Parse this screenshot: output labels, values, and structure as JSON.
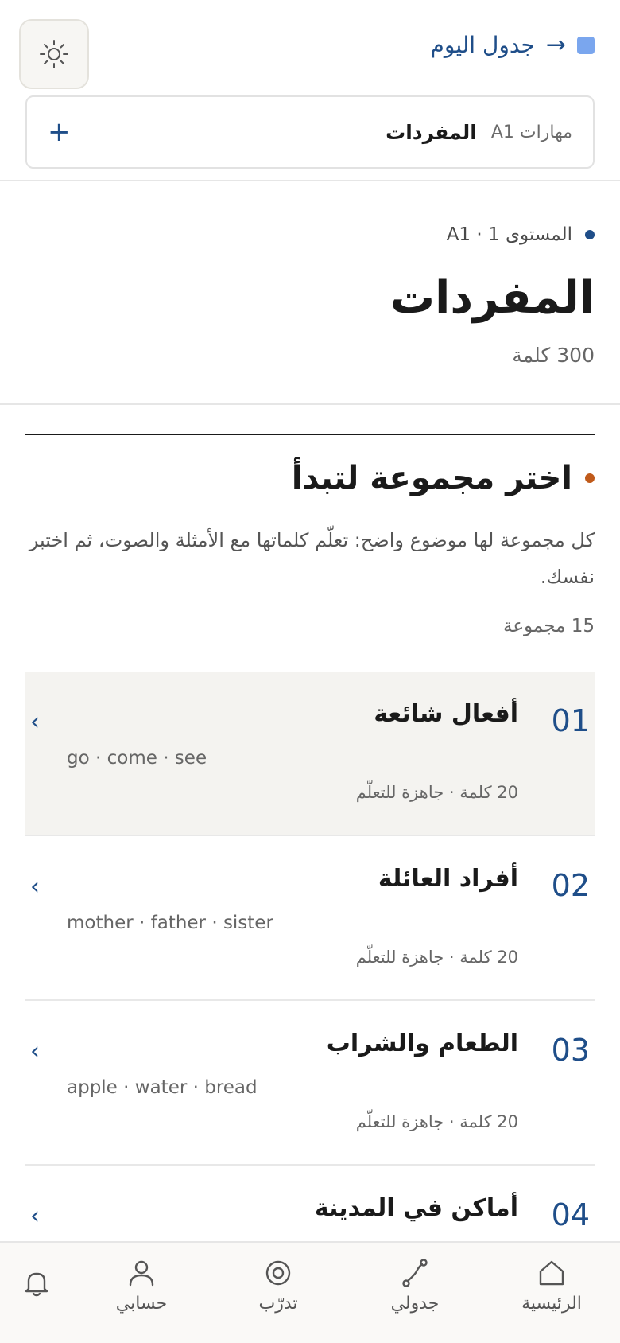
{
  "topbar": {
    "today_link": "جدول اليوم",
    "arrow": "→",
    "theme_icon": "sun-icon"
  },
  "breadcrumb": {
    "skills": "مهارات A1",
    "current": "المفردات",
    "add": "+"
  },
  "header": {
    "level": "المستوى 1 · A1",
    "title": "المفردات",
    "word_count": "300 كلمة"
  },
  "choose": {
    "title": "اختر مجموعة لتبدأ",
    "description": "كل مجموعة لها موضوع واضح: تعلّم كلماتها مع الأمثلة والصوت، ثم اختبر نفسك.",
    "group_count": "15 مجموعة"
  },
  "groups": [
    {
      "num": "01",
      "title": "أفعال شائعة",
      "words": "go · come · see",
      "meta": "20 كلمة · جاهزة للتعلّم",
      "chevron": "›"
    },
    {
      "num": "02",
      "title": "أفراد العائلة",
      "words": "mother · father · sister",
      "meta": "20 كلمة · جاهزة للتعلّم",
      "chevron": "›"
    },
    {
      "num": "03",
      "title": "الطعام والشراب",
      "words": "apple · water · bread",
      "meta": "20 كلمة · جاهزة للتعلّم",
      "chevron": "›"
    },
    {
      "num": "04",
      "title": "أماكن في المدينة",
      "words": "",
      "meta": "",
      "chevron": "›"
    }
  ],
  "nav": {
    "home": "الرئيسية",
    "schedule": "جدولي",
    "train": "تدرّب",
    "account": "حسابي",
    "notifications_icon": "bell-icon"
  },
  "colors": {
    "accent": "#1f4e89",
    "accent_light": "#7aa6ee",
    "orange_dot": "#c05a1a",
    "active_row": "#f4f3f0"
  }
}
